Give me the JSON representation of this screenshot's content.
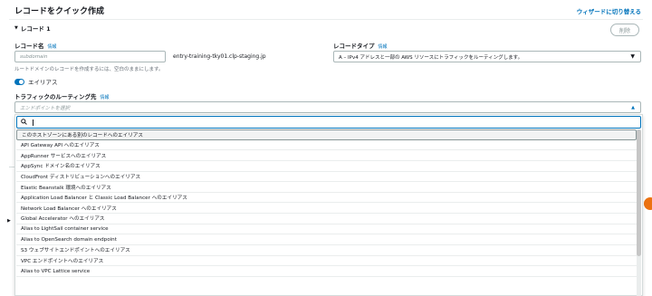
{
  "header": {
    "title": "レコードをクイック作成",
    "switch_link": "ウィザードに切り替える"
  },
  "record": {
    "header": "レコード 1",
    "delete_label": "削除",
    "name_label": "レコード名",
    "info": "情報",
    "name_placeholder": "subdomain",
    "domain_suffix": "entry-training-tky01.clp-staging.jp",
    "name_hint": "ルートドメインのレコードを作成するには、空白のままにします。",
    "type_label": "レコードタイプ",
    "type_value": "A – IPv4 アドレスと一部の AWS リソースにトラフィックをルーティングします。",
    "alias_label": "エイリアス",
    "alias_enabled": true,
    "routing_label": "トラフィックのルーティング先",
    "endpoint_placeholder": "エンドポイントを選択"
  },
  "dropdown": {
    "search_value": "",
    "options": [
      "このホストゾーンにある別のレコードへのエイリアス",
      "API Gateway API へのエイリアス",
      "AppRunner サービスへのエイリアス",
      "AppSync ドメイン名のエイリアス",
      "CloudFront ディストリビューションへのエイリアス",
      "Elastic Beanstalk 環境へのエイリアス",
      "Application Load Balancer と Classic Load Balancer へのエイリアス",
      "Network Load Balancer へのエイリアス",
      "Global Accelerator へのエイリアス",
      "Alias to LightSail container service",
      "Alias to OpenSearch domain endpoint",
      "S3 ウェブサイトエンドポイントへのエイリアス",
      "VPC エンドポイントへのエイリアス",
      "Alias to VPC Lattice service"
    ]
  },
  "colors": {
    "accent": "#0073bb",
    "orange": "#ec7211"
  }
}
